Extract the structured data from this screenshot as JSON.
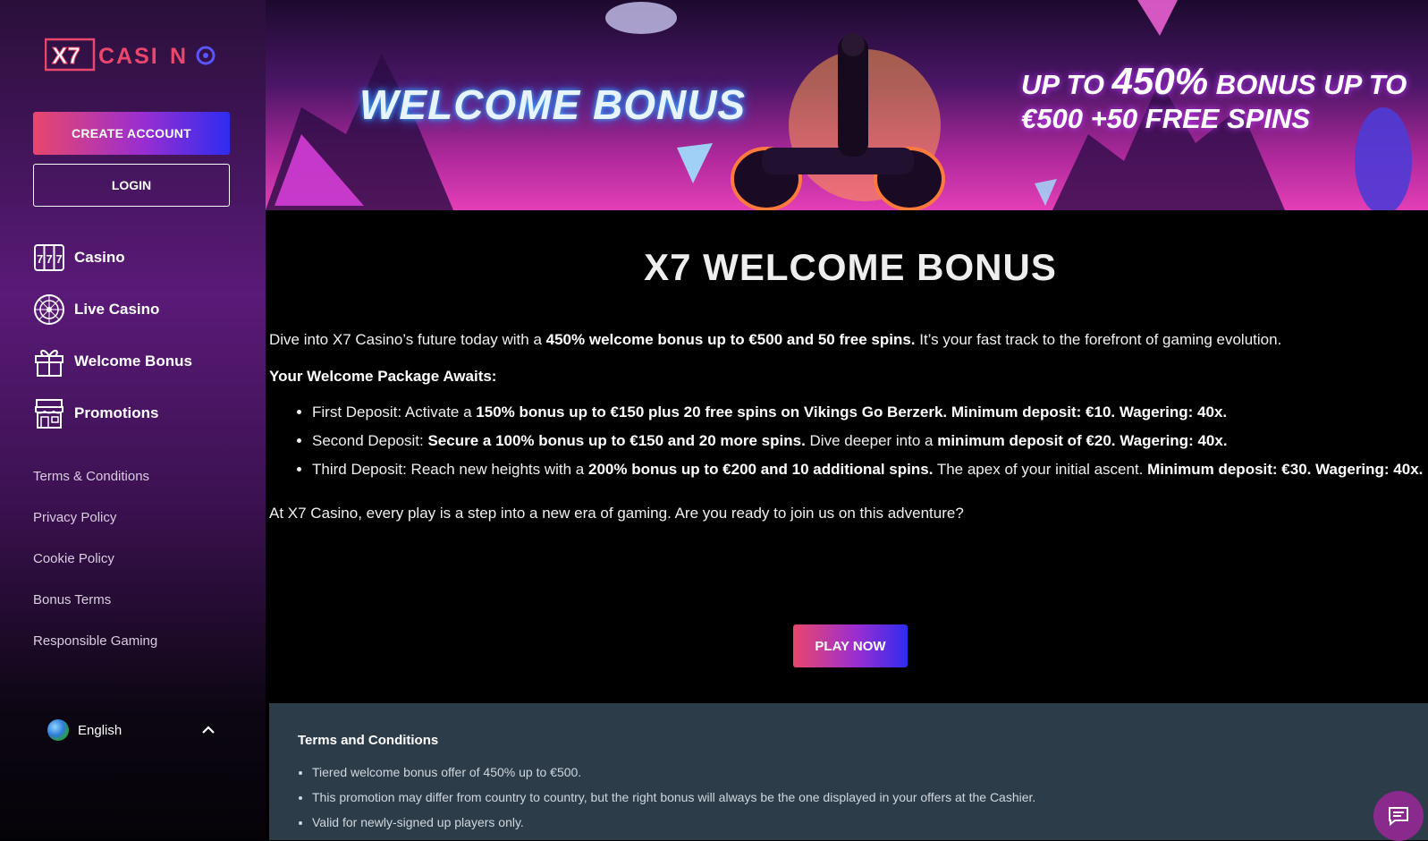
{
  "sidebar": {
    "logo_text": "X7 CASINO",
    "create_account": "CREATE ACCOUNT",
    "login": "LOGIN",
    "nav": [
      {
        "label": "Casino",
        "icon": "slot-machine-icon"
      },
      {
        "label": "Live Casino",
        "icon": "roulette-icon"
      },
      {
        "label": "Welcome Bonus",
        "icon": "gift-icon"
      },
      {
        "label": "Promotions",
        "icon": "store-icon"
      }
    ],
    "links": [
      "Terms & Conditions",
      "Privacy Policy",
      "Cookie Policy",
      "Bonus Terms",
      "Responsible Gaming"
    ],
    "language": "English"
  },
  "banner": {
    "headline": "WELCOME BONUS",
    "offer_prefix": "UP TO",
    "offer_percent": "450%",
    "offer_mid": "BONUS UP TO",
    "offer_line2": "€500 +50 FREE SPINS"
  },
  "main": {
    "title": "X7 WELCOME BONUS",
    "intro_a": "Dive into X7 Casino’s future today with a ",
    "intro_b": "450% welcome bonus up to €500 and 50 free spins.",
    "intro_c": " It’s your fast track to the forefront of gaming evolution.",
    "package_heading": "Your Welcome Package Awaits:",
    "bullets": [
      {
        "a": "First Deposit: Activate a ",
        "b": "150% bonus up to €150 plus 20 free spins on Vikings Go Berzerk. Minimum deposit: €10. Wagering: 40x.",
        "c": "",
        "d": ""
      },
      {
        "a": "Second Deposit: ",
        "b": "Secure a 100% bonus up to €150 and 20 more spins.",
        "c": " Dive deeper into a ",
        "d": "minimum deposit of €20. Wagering: 40x."
      },
      {
        "a": "Third Deposit: Reach new heights with a ",
        "b": "200% bonus up to €200 and 10 additional spins.",
        "c": " The apex of your initial ascent. ",
        "d": "Minimum deposit: €30. Wagering: 40x."
      }
    ],
    "outro": "At X7 Casino, every play is a step into a new era of gaming. Are you ready to join us on this adventure?",
    "play_now": "PLAY NOW"
  },
  "terms": {
    "title": "Terms and Conditions",
    "items": [
      "Tiered welcome bonus offer of 450% up to €500.",
      "This promotion may differ from country to country, but the right bonus will always be the one displayed in your offers at the Cashier.",
      "Valid for newly-signed up players only."
    ]
  },
  "colors": {
    "accent_start": "#e9476b",
    "accent_end": "#2f2cf0",
    "terms_bg": "#2c3c49",
    "chat_bg": "#8a2a8c"
  }
}
